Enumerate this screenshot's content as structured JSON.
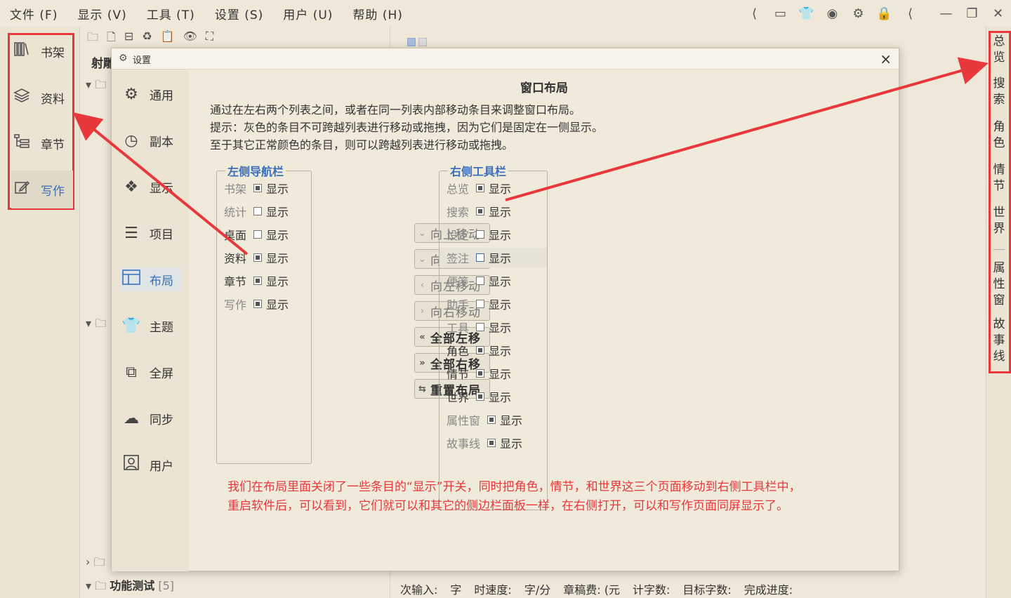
{
  "menubar": {
    "items": [
      "文件 (F)",
      "显示 (V)",
      "工具 (T)",
      "设置 (S)",
      "用户 (U)",
      "帮助 (H)"
    ]
  },
  "window_controls": {
    "minimize": "—",
    "maximize": "❐",
    "close": "✕"
  },
  "left_sidebar": {
    "items": [
      {
        "label": "书架",
        "icon": "bookshelf-icon"
      },
      {
        "label": "资料",
        "icon": "layers-icon"
      },
      {
        "label": "章节",
        "icon": "chapter-tree-icon"
      },
      {
        "label": "写作",
        "icon": "edit-icon"
      }
    ],
    "active": "写作"
  },
  "project_panel": {
    "title": "射雕",
    "tree_root": "功能测试",
    "tree_root_count": "[5]"
  },
  "status_bar": {
    "items": [
      "次输入:",
      "字",
      "时速度:",
      "字/分",
      "章稿费: (元",
      "计字数:",
      "目标字数:",
      "完成进度:"
    ]
  },
  "right_toolbar": {
    "items": [
      "总览",
      "搜索",
      "角色",
      "情节",
      "世界",
      "属性窗",
      "故事线"
    ]
  },
  "dialog": {
    "title": "设置",
    "close": "×",
    "nav": [
      {
        "label": "通用",
        "icon": "gear-icon"
      },
      {
        "label": "副本",
        "icon": "backup-clock-icon"
      },
      {
        "label": "显示",
        "icon": "display-grid-icon"
      },
      {
        "label": "项目",
        "icon": "project-list-icon"
      },
      {
        "label": "布局",
        "icon": "layout-icon"
      },
      {
        "label": "主题",
        "icon": "tshirt-icon"
      },
      {
        "label": "全屏",
        "icon": "fullscreen-cast-icon"
      },
      {
        "label": "同步",
        "icon": "cloud-sync-icon"
      },
      {
        "label": "用户",
        "icon": "user-icon"
      }
    ],
    "active_nav": "布局",
    "heading": "窗口布局",
    "desc": [
      "通过在左右两个列表之间，或者在同一列表内部移动条目来调整窗口布局。",
      "提示：灰色的条目不可跨越列表进行移动或拖拽，因为它们是固定在一侧显示。",
      "至于其它正常颜色的条目，则可以跨越列表进行移动或拖拽。"
    ],
    "show_label": "显示",
    "left_list": {
      "title": "左侧导航栏",
      "items": [
        {
          "name": "书架",
          "checked": true,
          "fixed": true
        },
        {
          "name": "统计",
          "checked": false,
          "fixed": true
        },
        {
          "name": "桌面",
          "checked": false,
          "fixed": false
        },
        {
          "name": "资料",
          "checked": true,
          "fixed": false
        },
        {
          "name": "章节",
          "checked": true,
          "fixed": false
        },
        {
          "name": "写作",
          "checked": true,
          "fixed": true
        }
      ]
    },
    "right_list": {
      "title": "右侧工具栏",
      "items": [
        {
          "name": "总览",
          "checked": true,
          "fixed": true
        },
        {
          "name": "搜索",
          "checked": true,
          "fixed": true
        },
        {
          "name": "设定",
          "checked": false,
          "fixed": true
        },
        {
          "name": "签注",
          "checked": false,
          "fixed": true,
          "selected": true
        },
        {
          "name": "便笺",
          "checked": false,
          "fixed": true
        },
        {
          "name": "助手",
          "checked": false,
          "fixed": true
        },
        {
          "name": "工具",
          "checked": false,
          "fixed": true
        },
        {
          "name": "角色",
          "checked": true,
          "fixed": false
        },
        {
          "name": "情节",
          "checked": true,
          "fixed": false
        },
        {
          "name": "世界",
          "checked": true,
          "fixed": false
        },
        {
          "name": "属性窗",
          "checked": true,
          "fixed": true
        },
        {
          "name": "故事线",
          "checked": true,
          "fixed": true
        }
      ]
    },
    "buttons": [
      {
        "label": "向上移动",
        "arrow": "⌄",
        "enabled": false
      },
      {
        "label": "向下移动",
        "arrow": "⌄",
        "enabled": false
      },
      {
        "label": "向左移动",
        "arrow": "‹",
        "enabled": false
      },
      {
        "label": "向右移动",
        "arrow": "›",
        "enabled": false
      },
      {
        "label": "全部左移",
        "arrow": "«",
        "enabled": true
      },
      {
        "label": "全部右移",
        "arrow": "»",
        "enabled": true
      },
      {
        "label": "重置布局",
        "arrow": "⇆",
        "enabled": true
      }
    ],
    "annotation": [
      "我们在布局里面关闭了一些条目的“显示”开关，同时把角色，情节，和世界这三个页面移动到右侧工具栏中，",
      "重启软件后，可以看到，它们就可以和其它的侧边栏面板一样，在右侧打开，可以和写作页面同屏显示了。"
    ]
  },
  "colors": {
    "accent": "#3a6fb8",
    "annotation": "#e8383b",
    "background": "#efe8d8"
  }
}
